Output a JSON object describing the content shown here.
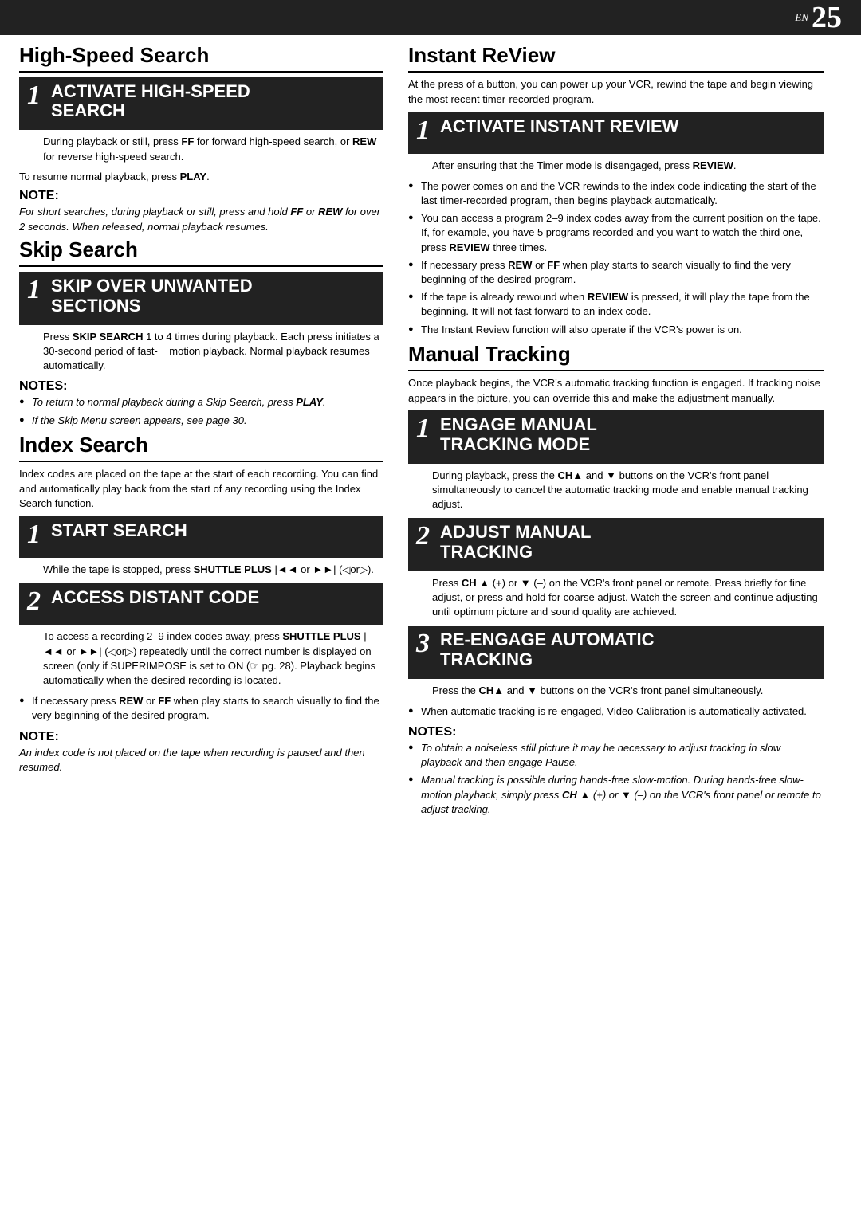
{
  "header": {
    "en_label": "EN",
    "page_number": "25"
  },
  "left": {
    "high_speed_search": {
      "title": "High-Speed Search",
      "step1_box_title": "ACTIVATE HIGH-SPEED SEARCH",
      "step1_text": "During playback or still, press FF for forward high-speed search, or REW for reverse high-speed search.",
      "resume_text": "To resume normal playback, press PLAY.",
      "note_title": "NOTE:",
      "note_text": "For short searches, during playback or still, press and hold FF or REW for over 2 seconds. When released, normal playback resumes."
    },
    "skip_search": {
      "title": "Skip Search",
      "step1_box_title": "SKIP OVER UNWANTED SECTIONS",
      "step1_text": "Press SKIP SEARCH 1 to 4 times during playback. Each press initiates a 30-second period of fast-    motion playback. Normal playback resumes automatically.",
      "notes_title": "NOTES:",
      "bullet1": "To return to normal playback during a Skip Search, press PLAY.",
      "bullet2": "If the Skip Menu screen appears, see page 30."
    },
    "index_search": {
      "title": "Index Search",
      "intro": "Index codes are placed on the tape at the start of each recording. You can find and automatically play back from the start of any recording using the Index Search function.",
      "step1_box_title": "START SEARCH",
      "step1_text": "While the tape is stopped, press SHUTTLE PLUS |◄◄ or ►►| (◁or▷).",
      "step2_box_title": "ACCESS DISTANT CODE",
      "step2_text": "To access a recording 2–9 index codes away, press SHUTTLE PLUS |◄◄ or ►►| (◁or▷) repeatedly until the correct number is displayed on screen (only if SUPERIMPOSE is set to ON (☞ pg. 28). Playback begins automatically when the desired recording is located.",
      "note_title": "NOTE:",
      "note_text": "An index code is not placed on the tape when recording is paused and then resumed.",
      "bullet1": "If necessary press REW or FF when play starts to search visually to find the very beginning of the desired program."
    }
  },
  "right": {
    "instant_review": {
      "title": "Instant ReView",
      "intro": "At the press of a button, you can power up your VCR, rewind the tape and begin viewing the most recent timer-recorded program.",
      "step1_box_title": "ACTIVATE INSTANT REVIEW",
      "step1_text": "After ensuring that the Timer mode is disengaged, press REVIEW.",
      "bullet1": "The power comes on and the VCR rewinds to the index code indicating the start of the last timer-recorded program, then begins playback automatically.",
      "bullet2": "You can access a program 2–9 index codes away from the current position on the tape. If, for example, you have 5 programs recorded and you want to watch the third one, press REVIEW three times.",
      "bullet3": "If necessary press REW or FF when play starts to search visually to find the very beginning of the desired program.",
      "bullet4": "If the tape is already rewound when REVIEW is pressed, it will play the tape from the beginning. It will not fast forward to an index code.",
      "bullet5": "The Instant Review function will also operate if the VCR's power is on."
    },
    "manual_tracking": {
      "title": "Manual Tracking",
      "intro": "Once playback begins, the VCR's automatic tracking function is engaged. If tracking noise appears in the picture, you can override this and make the adjustment manually.",
      "step1_box_title": "ENGAGE MANUAL TRACKING MODE",
      "step1_text": "During playback, press the CH▲ and ▼ buttons on the VCR's front panel simultaneously to cancel the automatic tracking mode and enable manual tracking adjust.",
      "step2_box_title": "ADJUST MANUAL TRACKING",
      "step2_text": "Press CH ▲ (+) or ▼ (–) on the VCR's front panel or remote. Press briefly for fine adjust, or press and hold for coarse adjust. Watch the screen and continue adjusting until optimum picture and sound quality are achieved.",
      "step3_box_title": "RE-ENGAGE AUTOMATIC TRACKING",
      "step3_text": "Press the CH▲ and ▼ buttons on the VCR's front panel simultaneously.",
      "bullet1": "When automatic tracking is re-engaged, Video Calibration is automatically activated.",
      "notes_title": "NOTES:",
      "notes_bullet1": "To obtain a noiseless still picture it may be necessary to adjust tracking in slow playback and then engage Pause.",
      "notes_bullet2": "Manual tracking is possible during hands-free slow-motion. During hands-free slow-motion playback, simply press CH ▲ (+) or ▼ (–) on the VCR's front panel or remote to adjust tracking."
    }
  }
}
